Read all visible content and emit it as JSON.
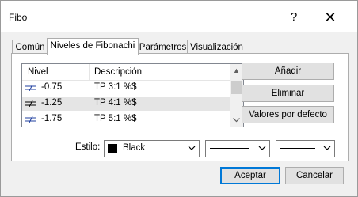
{
  "window": {
    "title": "Fibo",
    "help_label": "?",
    "close_label": "✕"
  },
  "tabs": [
    {
      "label": "Común"
    },
    {
      "label": "Niveles de Fibonachi"
    },
    {
      "label": "Parámetros"
    },
    {
      "label": "Visualización"
    }
  ],
  "list": {
    "headers": {
      "level": "Nivel",
      "description": "Descripción"
    },
    "rows": [
      {
        "level": "-0.75",
        "description": "TP 3:1 %$"
      },
      {
        "level": "-1.25",
        "description": "TP 4:1 %$"
      },
      {
        "level": "-1.75",
        "description": "TP 5:1 %$"
      }
    ],
    "selected_row": 1
  },
  "side_buttons": {
    "add": "Añadir",
    "remove": "Eliminar",
    "defaults": "Valores por defecto"
  },
  "style": {
    "label": "Estilo:",
    "color_name": "Black",
    "color_hex": "#000000"
  },
  "footer": {
    "ok": "Aceptar",
    "cancel": "Cancelar"
  }
}
